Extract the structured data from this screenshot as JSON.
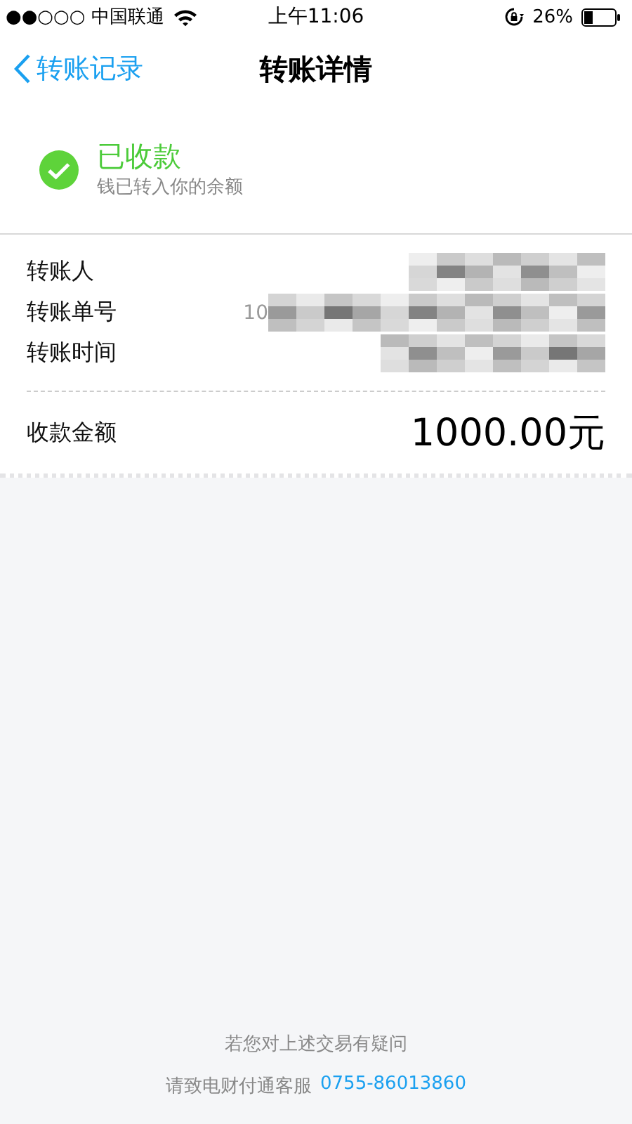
{
  "status_bar": {
    "carrier": "●●○○○ 中国联通",
    "time": "上午11:06",
    "battery": "26%"
  },
  "nav": {
    "back_label": "转账记录",
    "title": "转账详情"
  },
  "status": {
    "title": "已收款",
    "subtitle": "钱已转入你的余额"
  },
  "details": [
    {
      "label": "转账人",
      "redacted": true
    },
    {
      "label": "转账单号",
      "value": "10",
      "redacted": true
    },
    {
      "label": "转账时间",
      "redacted": true
    }
  ],
  "amount": {
    "label": "收款金额",
    "value": "1000.00元"
  },
  "footer": {
    "line1": "若您对上述交易有疑问",
    "line2": "请致电财付通客服",
    "phone": "0755-86013860"
  }
}
